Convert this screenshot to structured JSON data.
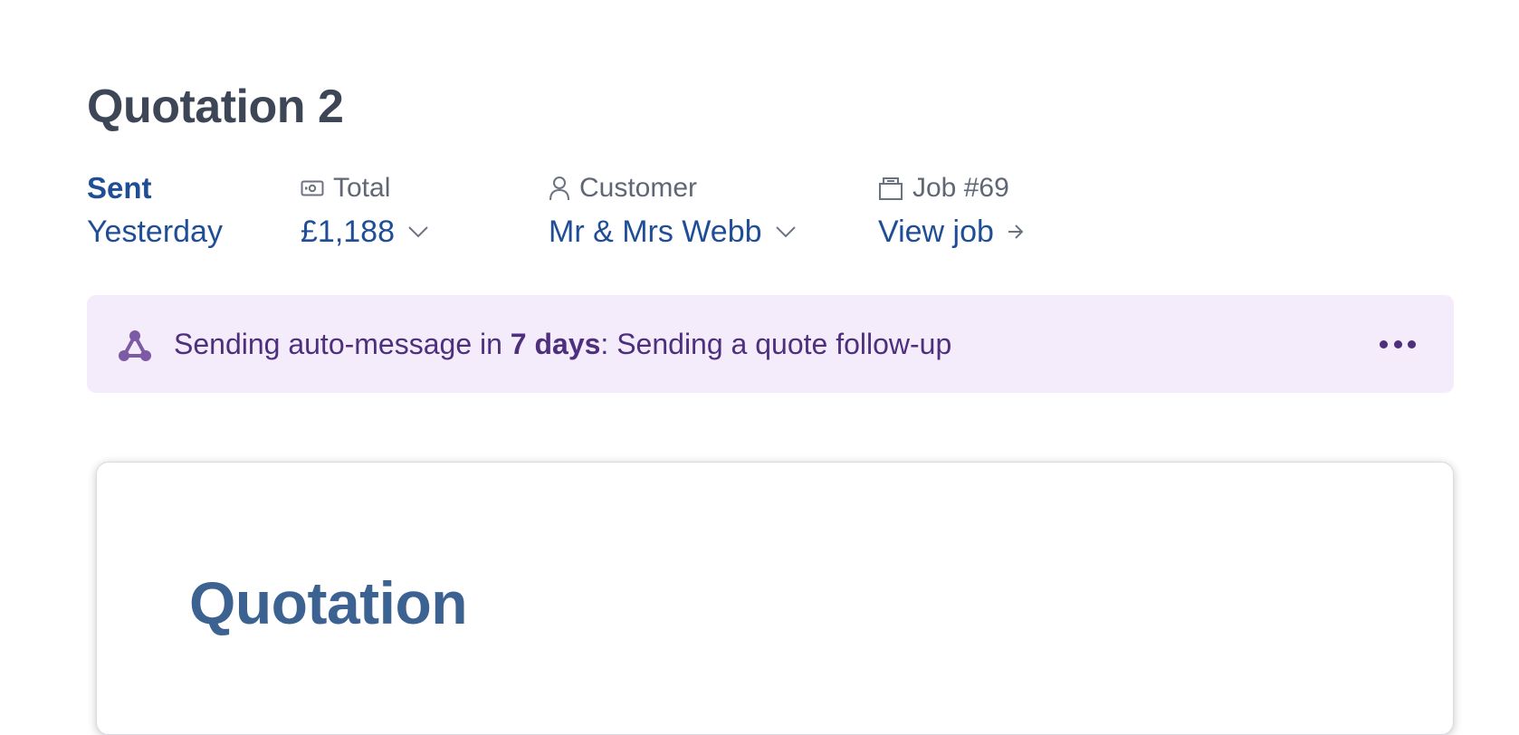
{
  "page": {
    "title": "Quotation 2"
  },
  "meta": {
    "status": {
      "label": "Sent",
      "value": "Yesterday"
    },
    "total": {
      "label": "Total",
      "value": "£1,188",
      "icon": "cash-icon"
    },
    "customer": {
      "label": "Customer",
      "value": "Mr & Mrs Webb",
      "icon": "person-icon"
    },
    "job": {
      "label": "Job #69",
      "link": "View job",
      "icon": "folder-icon"
    }
  },
  "banner": {
    "icon": "automation-icon",
    "prefix": "Sending auto-message in ",
    "highlight": "7 days",
    "suffix": ": Sending a quote follow-up",
    "more_icon": "more-dots-icon"
  },
  "document": {
    "title": "Quotation"
  },
  "colors": {
    "link": "#1f4e97",
    "heading": "#3d4656",
    "banner_bg": "#f4ecfa",
    "banner_text": "#4d2f7d",
    "doc_title": "#3c6292"
  }
}
